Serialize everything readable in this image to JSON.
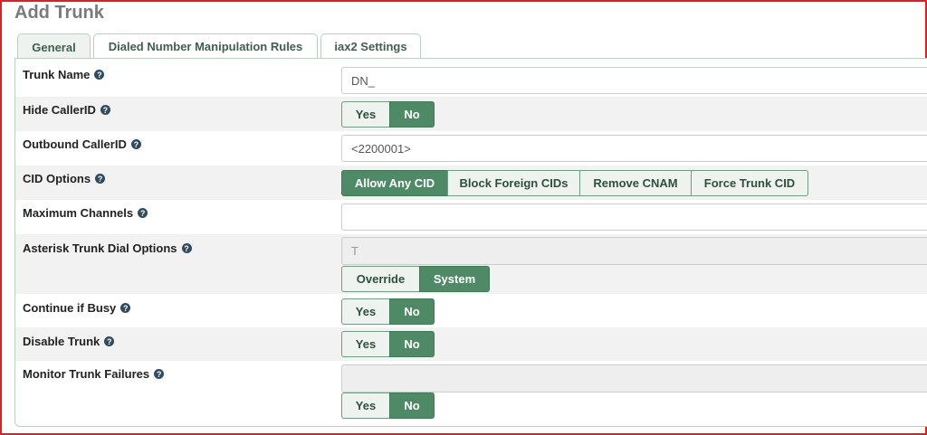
{
  "page": {
    "title": "Add Trunk"
  },
  "tabs": [
    {
      "label": "General",
      "active": true
    },
    {
      "label": "Dialed Number Manipulation Rules",
      "active": false
    },
    {
      "label": "iax2 Settings",
      "active": false
    }
  ],
  "help_glyph": "?",
  "fields": {
    "trunk_name": {
      "label": "Trunk Name",
      "value": "DN_"
    },
    "hide_callerid": {
      "label": "Hide CallerID",
      "options": [
        "Yes",
        "No"
      ],
      "selected": "No"
    },
    "outbound_callerid": {
      "label": "Outbound CallerID",
      "value": "<2200001>"
    },
    "cid_options": {
      "label": "CID Options",
      "options": [
        "Allow Any CID",
        "Block Foreign CIDs",
        "Remove CNAM",
        "Force Trunk CID"
      ],
      "selected": "Allow Any CID"
    },
    "max_channels": {
      "label": "Maximum Channels",
      "value": ""
    },
    "dial_options": {
      "label": "Asterisk Trunk Dial Options",
      "value": "T",
      "options": [
        "Override",
        "System"
      ],
      "selected": "System"
    },
    "continue_if_busy": {
      "label": "Continue if Busy",
      "options": [
        "Yes",
        "No"
      ],
      "selected": "No"
    },
    "disable_trunk": {
      "label": "Disable Trunk",
      "options": [
        "Yes",
        "No"
      ],
      "selected": "No"
    },
    "monitor_failures": {
      "label": "Monitor Trunk Failures",
      "value": "",
      "options": [
        "Yes",
        "No"
      ],
      "selected": "No"
    }
  },
  "colors": {
    "accent": "#4f8a66",
    "border": "#e02020"
  }
}
